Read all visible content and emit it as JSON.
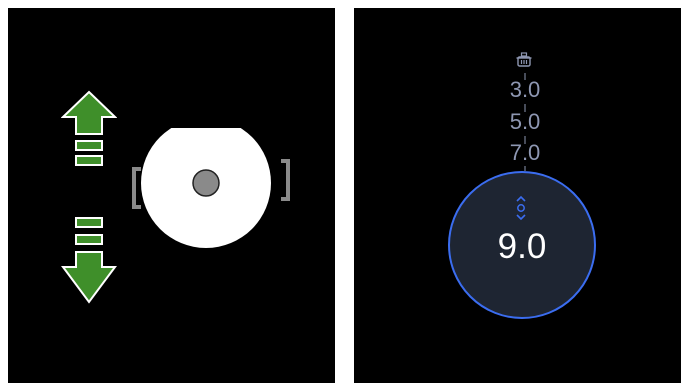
{
  "left_panel": {
    "arrow_up_color": "#3f8f2a",
    "arrow_down_color": "#3f8f2a",
    "pot_color": "#ffffff",
    "pot_knob_color": "#8a8a8a"
  },
  "right_panel": {
    "icon": "pot-steam-icon",
    "scale_values": [
      "3.0",
      "5.0",
      "7.0"
    ],
    "current_value": "9.0",
    "knob_ring_color": "#3b6df0",
    "knob_fill_color": "#1e2532",
    "scale_color": "#8e97b2"
  }
}
